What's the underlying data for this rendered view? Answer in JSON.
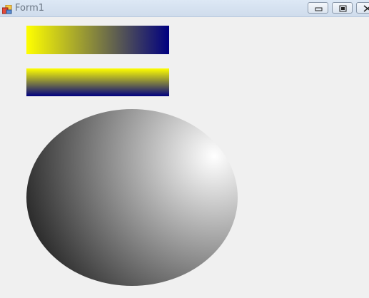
{
  "window": {
    "title": "Form1"
  },
  "title_buttons": {
    "minimize": "minimize-icon",
    "maximize": "maximize-icon",
    "close": "close-icon"
  },
  "shapes": {
    "horizontal_gradient_rect": {
      "from_color": "#ffff00",
      "to_color": "#000080"
    },
    "vertical_gradient_rect": {
      "from_color": "#ffff00",
      "to_color": "#000080"
    },
    "radial_gradient_ellipse": {
      "highlight_color": "#ffffff",
      "edge_color": "#000000"
    }
  }
}
